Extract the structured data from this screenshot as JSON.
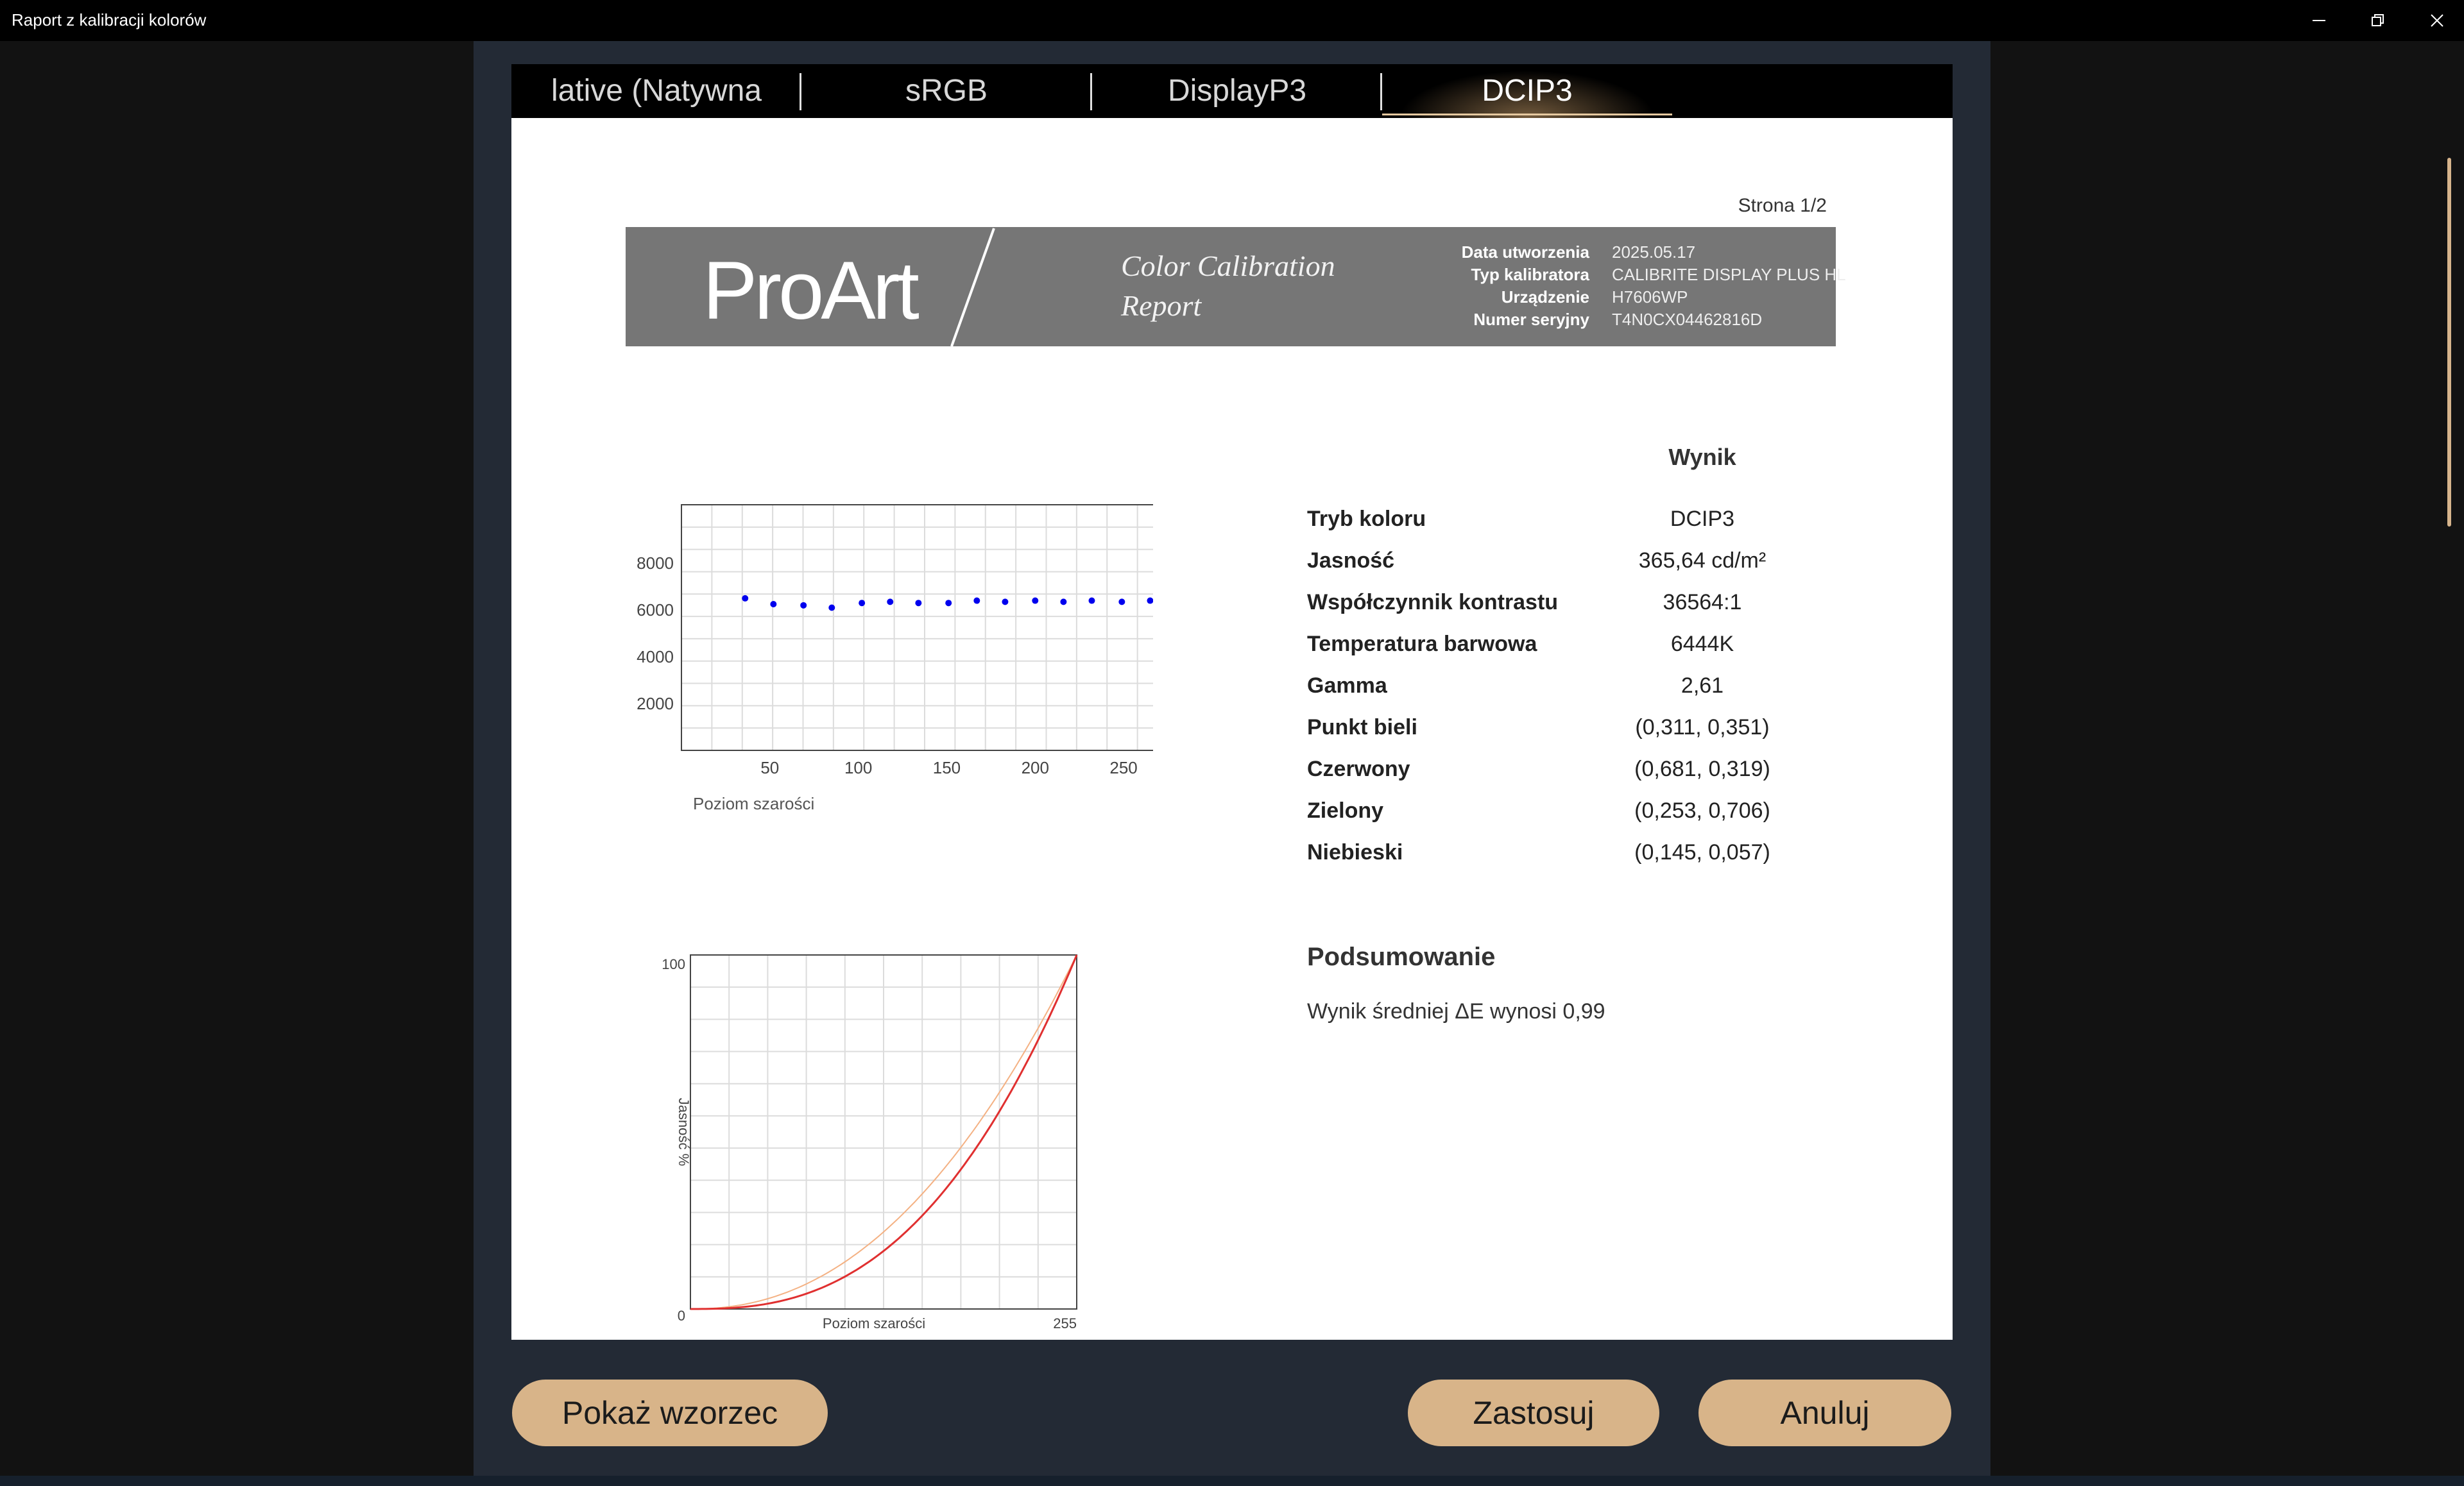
{
  "window": {
    "title": "Raport z kalibracji kolorów"
  },
  "tabs": [
    {
      "label": "lative (Natywna"
    },
    {
      "label": "sRGB"
    },
    {
      "label": "DisplayP3"
    },
    {
      "label": "DCIP3",
      "active": true
    }
  ],
  "report": {
    "page": "Strona 1/2",
    "logo": "ProArt",
    "title_line1": "Color Calibration",
    "title_line2": "Report",
    "meta": [
      {
        "label": "Data utworzenia",
        "value": "2025.05.17"
      },
      {
        "label": "Typ kalibratora",
        "value": "CALIBRITE DISPLAY PLUS HL"
      },
      {
        "label": "Urządzenie",
        "value": "H7606WP"
      },
      {
        "label": "Numer seryjny",
        "value": "T4N0CX04462816D"
      }
    ],
    "results_header": "Wynik",
    "results": [
      {
        "label": "Tryb koloru",
        "value": "DCIP3"
      },
      {
        "label": "Jasność",
        "value": "365,64 cd/m²"
      },
      {
        "label": "Współczynnik kontrastu",
        "value": "36564:1"
      },
      {
        "label": "Temperatura barwowa",
        "value": "6444K"
      },
      {
        "label": "Gamma",
        "value": "2,61"
      },
      {
        "label": "Punkt bieli",
        "value": "(0,311, 0,351)"
      },
      {
        "label": "Czerwony",
        "value": "(0,681, 0,319)"
      },
      {
        "label": "Zielony",
        "value": "(0,253, 0,706)"
      },
      {
        "label": "Niebieski",
        "value": "(0,145, 0,057)"
      }
    ],
    "summary_title": "Podsumowanie",
    "summary_text": "Wynik średniej ΔE wynosi 0,99"
  },
  "chart_data": [
    {
      "type": "scatter",
      "xlabel": "Poziom szarości",
      "ylabel": "",
      "xlim": [
        0,
        275
      ],
      "ylim": [
        0,
        10500
      ],
      "xticks": [
        50,
        100,
        150,
        200,
        250
      ],
      "yticks": [
        2000,
        4000,
        6000,
        8000
      ],
      "grid": true,
      "point_color": "#0000ee",
      "x": [
        36,
        52,
        69,
        85,
        102,
        118,
        134,
        151,
        167,
        183,
        200,
        216,
        232,
        249,
        265
      ],
      "y": [
        6500,
        6250,
        6200,
        6100,
        6300,
        6350,
        6300,
        6300,
        6400,
        6350,
        6400,
        6350,
        6400,
        6350,
        6400
      ]
    },
    {
      "type": "line",
      "xlabel": "Poziom szarości",
      "ylabel": "Jasność %",
      "xlim": [
        0,
        255
      ],
      "ylim": [
        0,
        100
      ],
      "x_tick_labels": [
        "255"
      ],
      "y_tick_labels": [
        "0",
        "100"
      ],
      "grid": true,
      "series": [
        {
          "color": "#f4b183",
          "gamma": 2.2
        },
        {
          "color": "#e03030",
          "gamma": 2.61
        }
      ]
    }
  ]
}
